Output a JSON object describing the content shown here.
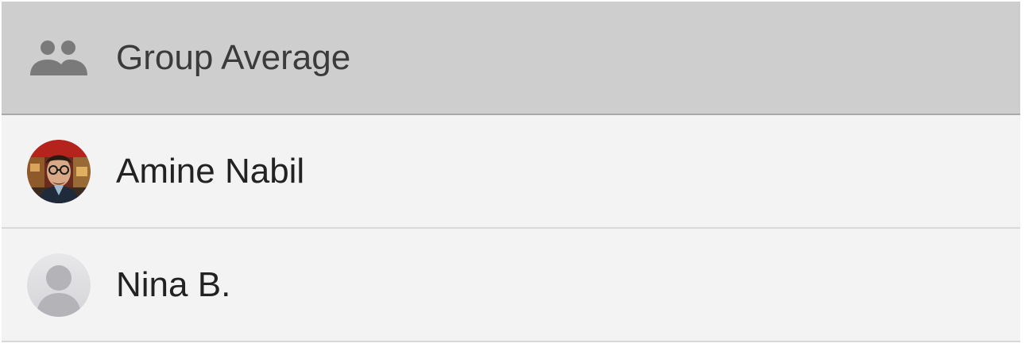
{
  "list": {
    "header": {
      "icon": "group-icon",
      "label": "Group Average"
    },
    "members": [
      {
        "name": "Amine Nabil",
        "avatar": "user-photo-avatar"
      },
      {
        "name": "Nina B.",
        "avatar": "default-person-avatar"
      }
    ]
  },
  "colors": {
    "header_bg": "#cecece",
    "row_bg": "#f3f3f3",
    "divider": "#d8d8d8",
    "icon_gray": "#7a7a7a"
  }
}
